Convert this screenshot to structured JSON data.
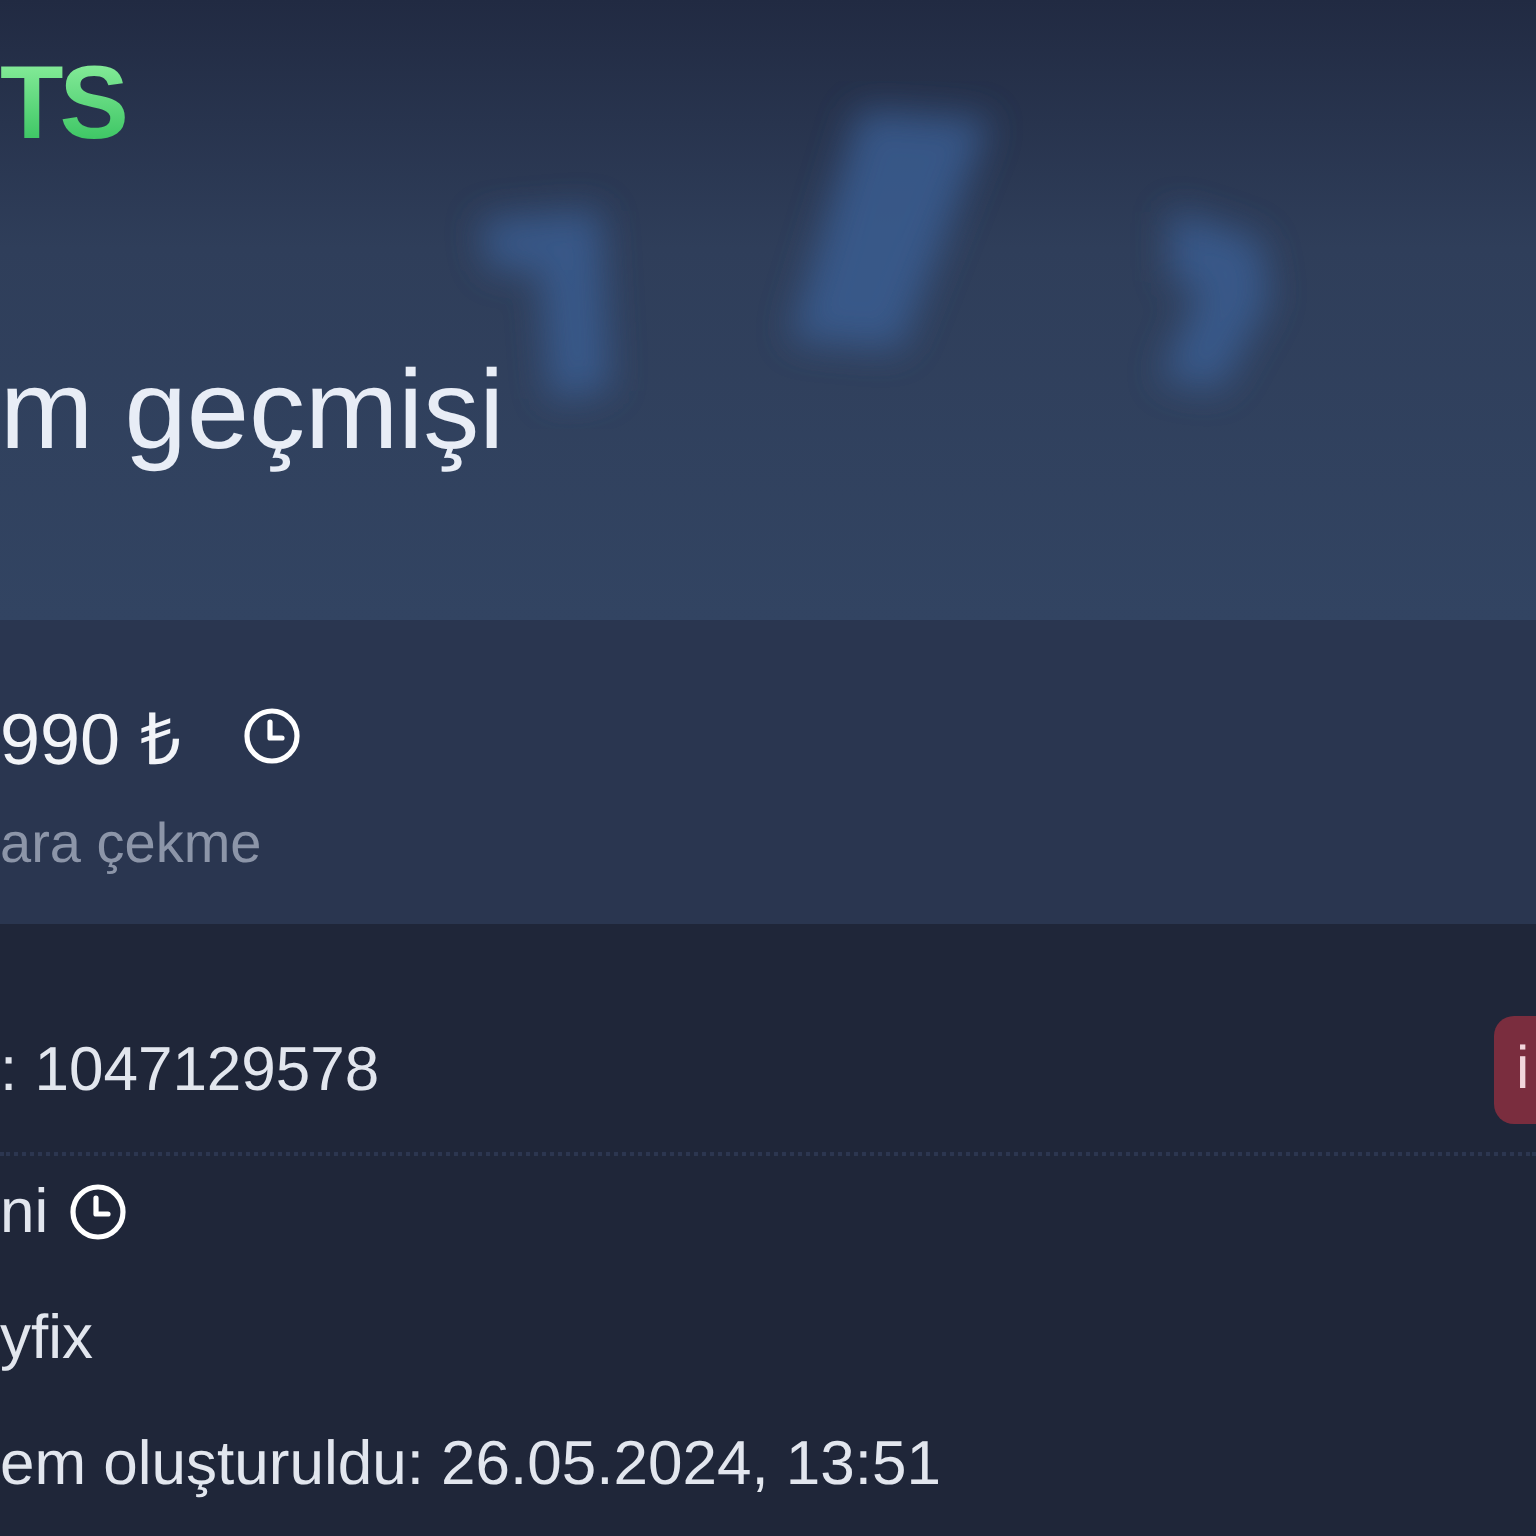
{
  "header": {
    "logo": "TS",
    "title": "m geçmişi"
  },
  "summary": {
    "amount": "990 ₺",
    "pending": true,
    "subtitle": "ara çekme"
  },
  "details": {
    "id_line": ": 1047129578",
    "badge": "i",
    "rows": [
      {
        "text": "ni",
        "pending": true
      },
      {
        "text": "yfix",
        "pending": false
      },
      {
        "text": "em oluşturuldu: 26.05.2024, 13:51",
        "pending": false
      }
    ]
  }
}
